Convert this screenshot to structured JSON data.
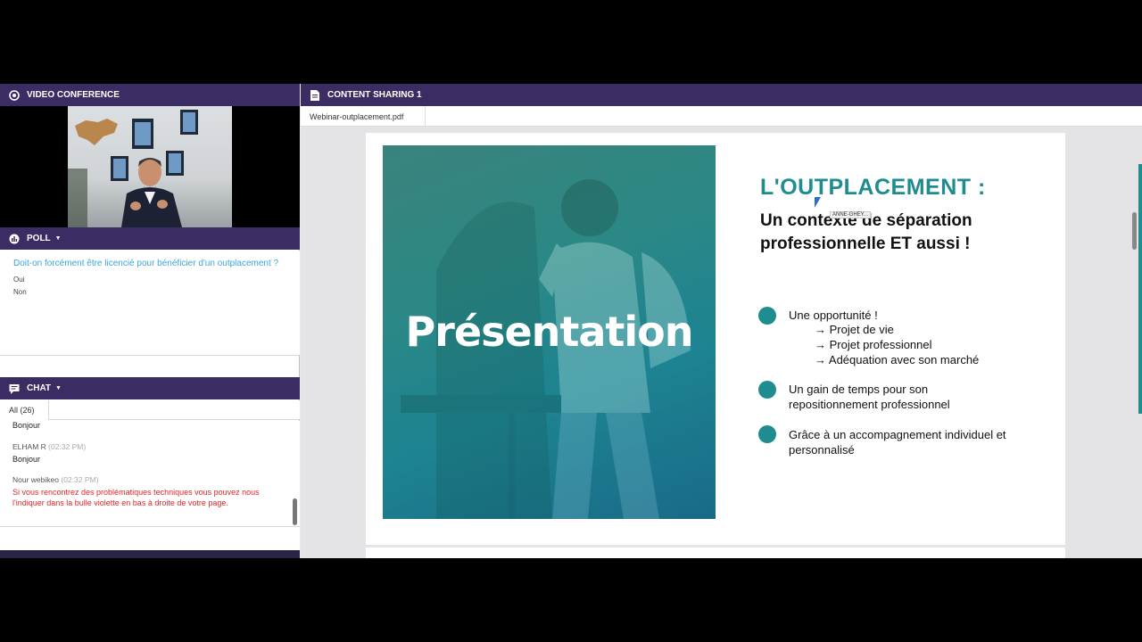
{
  "video_conference": {
    "title": "VIDEO CONFERENCE",
    "icon": "webcam-icon"
  },
  "poll": {
    "title": "POLL",
    "question": "Doit-on forcément être licencié pour bénéficier d'un outplacement ?",
    "options": [
      "Oui",
      "Non"
    ]
  },
  "chat": {
    "title": "CHAT",
    "tab_all": "All (26)",
    "partial_prev": "Bonjour",
    "messages": [
      {
        "author": "ELHAM R",
        "time": "(02:32 PM)",
        "text": "Bonjour",
        "color": "#222222"
      },
      {
        "author": "Nour webikeo",
        "time": "(02:32 PM)",
        "text": "Si vous rencontrez des problématiques techniques vous pouvez nous l'indiquer dans la bulle violette en bas à droite de votre page.",
        "color": "#e0252b"
      }
    ]
  },
  "content_sharing": {
    "title": "CONTENT SHARING 1",
    "file_tab": "Webinar-outplacement.pdf"
  },
  "slide": {
    "image_title": "Présentation",
    "heading": "L'OUTPLACEMENT :",
    "subheading": "Un contexte de séparation professionnelle ET aussi !",
    "cursor_label": "ANNE-GHEY...",
    "bullets": [
      {
        "text": "Une opportunité !",
        "subs": [
          "→ Projet de vie",
          "→ Projet professionnel",
          "→ Adéquation avec son marché"
        ]
      },
      {
        "text": "Un gain de temps pour son repositionnement professionnel",
        "subs": []
      },
      {
        "text": "Grâce à un accompagnement individuel et personnalisé",
        "subs": []
      }
    ]
  },
  "colors": {
    "header": "#3b2d63",
    "teal": "#1f8d8f",
    "poll_question": "#3aa6d8",
    "alert_red": "#e0252b"
  }
}
